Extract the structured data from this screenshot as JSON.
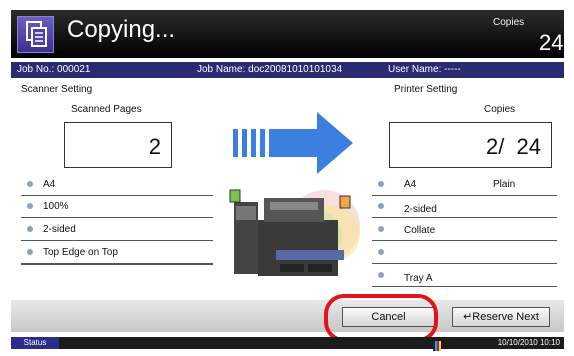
{
  "header": {
    "title": "Copying...",
    "copies_label": "Copies",
    "copies_count": "24"
  },
  "job": {
    "no": "Job No.: 000021",
    "name": "Job Name: doc20081010101034",
    "user": "User Name: -----"
  },
  "scanner": {
    "heading": "Scanner Setting",
    "pages_label": "Scanned Pages",
    "pages_value": "2",
    "settings": [
      "A4",
      "100%",
      "2-sided",
      "Top Edge on Top"
    ]
  },
  "printer": {
    "heading": "Printer Setting",
    "copies_label": "Copies",
    "copies_value": "2/  24",
    "settings": [
      {
        "left": "A4",
        "right": "Plain"
      },
      {
        "left": "2-sided",
        "right": ""
      },
      {
        "left": "Collate",
        "right": ""
      },
      {
        "left": "",
        "right": ""
      },
      {
        "left": "Tray A",
        "right": ""
      }
    ]
  },
  "buttons": {
    "cancel": "Cancel",
    "reserve_next": "Reserve Next"
  },
  "status": {
    "tab": "Status",
    "datetime": "10/10/2010  10:10"
  },
  "colors": {
    "accent": "#2a2a72",
    "arrow": "#3d7fe0",
    "highlight": "#e3131b"
  }
}
